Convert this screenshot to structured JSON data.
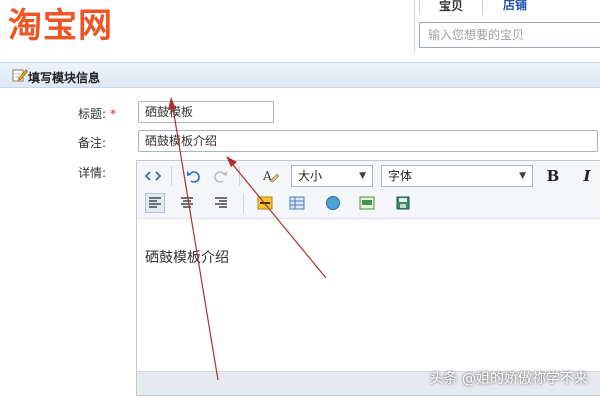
{
  "brand": {
    "logo_text": "淘宝网",
    "color": "#ee5522"
  },
  "search": {
    "tabs": [
      {
        "label": "宝贝",
        "active": true
      },
      {
        "label": "店铺",
        "active": false
      }
    ],
    "placeholder": "输入您想要的宝贝"
  },
  "panel": {
    "title": "填写模块信息",
    "icon": "edit-icon"
  },
  "form": {
    "title": {
      "label": "标题:",
      "required_mark": "*",
      "value": "硒鼓模板"
    },
    "note": {
      "label": "备注:",
      "value": "硒鼓模板介绍"
    },
    "detail": {
      "label": "详情:"
    }
  },
  "editor": {
    "toolbar": {
      "source_icon": "code-icon",
      "undo_icon": "undo-icon",
      "redo_icon": "redo-icon",
      "clear_format_icon": "clear-format-icon",
      "size_select": "大小",
      "font_select": "字体",
      "bold": "B",
      "italic": "I",
      "align_icons": [
        "align-left-icon",
        "align-center-icon",
        "align-right-icon"
      ],
      "insert_icons": [
        "link-icon",
        "table-icon",
        "globe-icon",
        "image-icon",
        "save-icon"
      ]
    },
    "content": "硒鼓模板介绍"
  },
  "watermark": "头条 @姐的娇傲祢学不来",
  "annotation_color": "#b03030"
}
